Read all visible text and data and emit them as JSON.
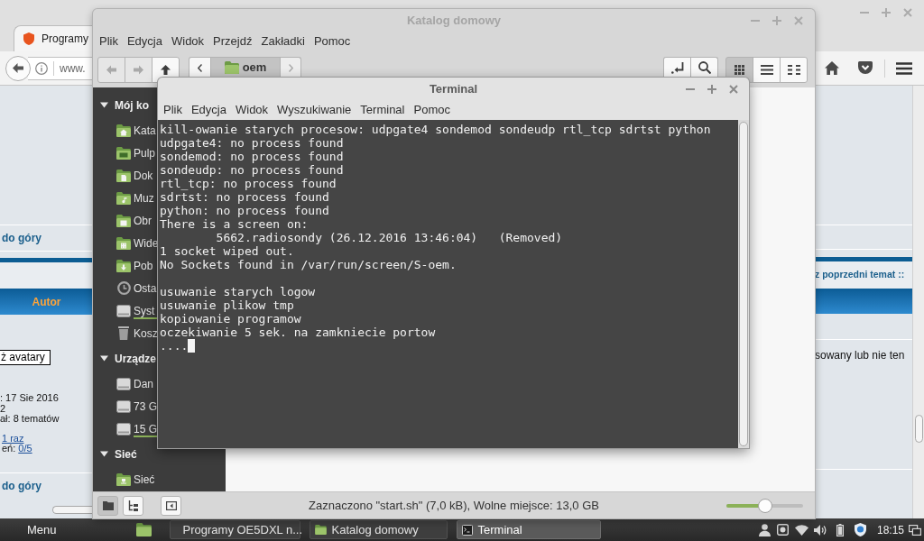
{
  "browser": {
    "tab_title": "Programy",
    "address": "www.",
    "page": {
      "left": {
        "top_link": "do góry",
        "column_header": "Autor",
        "avatar_button": "ż avatary",
        "profile_lines": [
          ": 17 Sie 2016",
          "2",
          "ał: 8 tematów"
        ],
        "stat_lines": [
          {
            "link": "1 raz"
          },
          {
            "label": "eń:",
            "link": "0/5"
          }
        ],
        "bottom_link": "do góry"
      },
      "right": {
        "nav_link": "z poprzedni temat ::",
        "post_text": "sowany lub nie ten"
      }
    }
  },
  "file_manager": {
    "title": "Katalog domowy",
    "menu": [
      "Plik",
      "Edycja",
      "Widok",
      "Przejdź",
      "Zakładki",
      "Pomoc"
    ],
    "nav_buttons": [
      {
        "kind": "back",
        "disabled": true
      },
      {
        "kind": "forward",
        "disabled": true
      },
      {
        "kind": "up",
        "disabled": false
      }
    ],
    "path": [
      {
        "label": "oem",
        "selected": true
      }
    ],
    "view_buttons": [
      {
        "kind": "icons",
        "selected": true
      },
      {
        "kind": "list",
        "selected": false
      },
      {
        "kind": "compact",
        "selected": false
      }
    ],
    "sidebar": [
      {
        "title": "Mój ko",
        "expanded": true,
        "items": [
          {
            "label": "Kata",
            "kind": "home",
            "usage_bar": false
          },
          {
            "label": "Pulp",
            "kind": "desktop",
            "usage_bar": false
          },
          {
            "label": "Dok",
            "kind": "documents",
            "usage_bar": false
          },
          {
            "label": "Muz",
            "kind": "music",
            "usage_bar": false
          },
          {
            "label": "Obr",
            "kind": "pictures",
            "usage_bar": false
          },
          {
            "label": "Wide",
            "kind": "videos",
            "usage_bar": false
          },
          {
            "label": "Pob",
            "kind": "downloads",
            "usage_bar": false
          },
          {
            "label": "Osta",
            "kind": "recent",
            "usage_bar": false
          },
          {
            "label": "Syst",
            "kind": "drive",
            "usage_bar": true
          },
          {
            "label": "Kosz",
            "kind": "trash",
            "usage_bar": false
          }
        ]
      },
      {
        "title": "Urządze",
        "expanded": true,
        "items": [
          {
            "label": "Dan",
            "kind": "drive",
            "usage_bar": false
          },
          {
            "label": "73 G",
            "kind": "drive",
            "usage_bar": false
          },
          {
            "label": "15 G",
            "kind": "drive",
            "usage_bar": true
          }
        ]
      },
      {
        "title": "Sieć",
        "expanded": true,
        "items": [
          {
            "label": "Sieć",
            "kind": "network",
            "usage_bar": false
          }
        ]
      }
    ],
    "pane_buttons": [
      {
        "kind": "places",
        "selected": true
      },
      {
        "kind": "tree",
        "selected": false
      }
    ],
    "status": "Zaznaczono \"start.sh\" (7,0 kB), Wolne miejsce: 13,0 GB",
    "zoom": {
      "level": 0.5
    }
  },
  "terminal": {
    "title": "Terminal",
    "menu": [
      "Plik",
      "Edycja",
      "Widok",
      "Wyszukiwanie",
      "Terminal",
      "Pomoc"
    ],
    "blocks": [
      {
        "lines": [
          "kill-owanie starych procesow: udpgate4 sondemod sondeudp rtl_tcp sdrtst python",
          "udpgate4: no process found",
          "sondemod: no process found",
          "sondeudp: no process found",
          "rtl_tcp: no process found",
          "sdrtst: no process found",
          "python: no process found",
          "There is a screen on:",
          "        5662.radiosondy (26.12.2016 13:46:04)   (Removed)",
          "1 socket wiped out.",
          "No Sockets found in /var/run/screen/S-oem."
        ]
      },
      {
        "lines": [
          "usuwanie starych logow",
          "usuwanie plikow tmp",
          "kopiowanie programow",
          "oczekiwanie 5 sek. na zamkniecie portow",
          "...."
        ]
      }
    ],
    "cursor": true
  },
  "taskbar": {
    "menu": "Menu",
    "windows": [
      {
        "title": "Programy OE5DXL n...",
        "kind": "browser",
        "selected": false
      },
      {
        "title": "Katalog domowy",
        "kind": "folder",
        "selected": false
      },
      {
        "title": "Terminal",
        "kind": "terminal",
        "selected": true
      }
    ],
    "clock": "18:15"
  }
}
